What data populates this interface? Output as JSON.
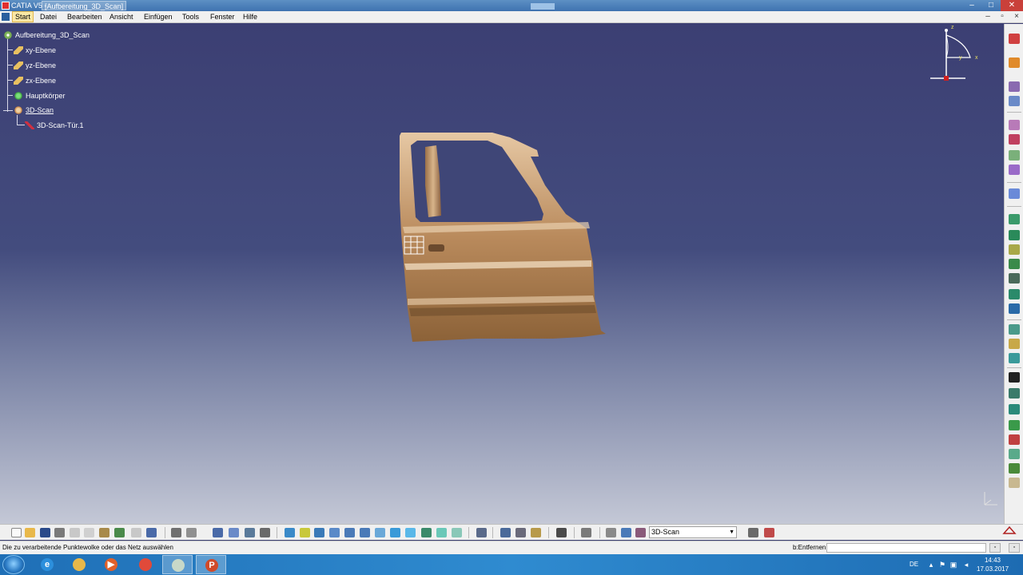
{
  "window": {
    "title_prefix": "CATIA V5 - ",
    "title_doc": "[Aufbereitung_3D_Scan]",
    "min_glyph": "–",
    "max_glyph": "□",
    "close_glyph": "✕"
  },
  "menu": {
    "items": [
      "Start",
      "Datei",
      "Bearbeiten",
      "Ansicht",
      "Einfügen",
      "Tools",
      "Fenster",
      "Hilfe"
    ],
    "active": "Start"
  },
  "spec_tree": {
    "root": "Aufbereitung_3D_Scan",
    "nodes": [
      {
        "label": "xy-Ebene",
        "icon": "plane-icon"
      },
      {
        "label": "yz-Ebene",
        "icon": "plane-icon"
      },
      {
        "label": "zx-Ebene",
        "icon": "plane-icon"
      },
      {
        "label": "Hauptkörper",
        "icon": "part-body-icon"
      },
      {
        "label": "3D-Scan",
        "icon": "scan-geoset-icon"
      }
    ],
    "child": {
      "label": "3D-Scan-Tür.1",
      "icon": "cloud-mesh-icon"
    }
  },
  "compass": {
    "x_label": "x",
    "y_label": "y",
    "z_label": "z"
  },
  "workbench_select": {
    "value": "3D-Scan"
  },
  "status": {
    "message": "Die zu verarbeitende Punktewolke oder das Netz auswählen",
    "command_label": "b:Entfernen",
    "command_value": ""
  },
  "taskbar": {
    "apps": [
      {
        "name": "internet-explorer-icon",
        "glyph": "e",
        "color": "#2c8fdc"
      },
      {
        "name": "file-explorer-icon",
        "glyph": "",
        "color": "#e8b84a"
      },
      {
        "name": "media-player-icon",
        "glyph": "▶",
        "color": "#e0602a"
      },
      {
        "name": "chrome-icon",
        "glyph": "",
        "color": "#e04a3a"
      },
      {
        "name": "catia-window-icon",
        "glyph": "",
        "color": "#c8d8c8"
      },
      {
        "name": "powerpoint-icon",
        "glyph": "P",
        "color": "#d04a2a"
      }
    ],
    "language": "DE",
    "time": "14:43",
    "date": "17.03.2017"
  },
  "colors": {
    "viewport_top": "#3c3f73",
    "viewport_bottom": "#c4c8d6",
    "door": "#b98a5c",
    "accent_red": "#c9403a"
  }
}
